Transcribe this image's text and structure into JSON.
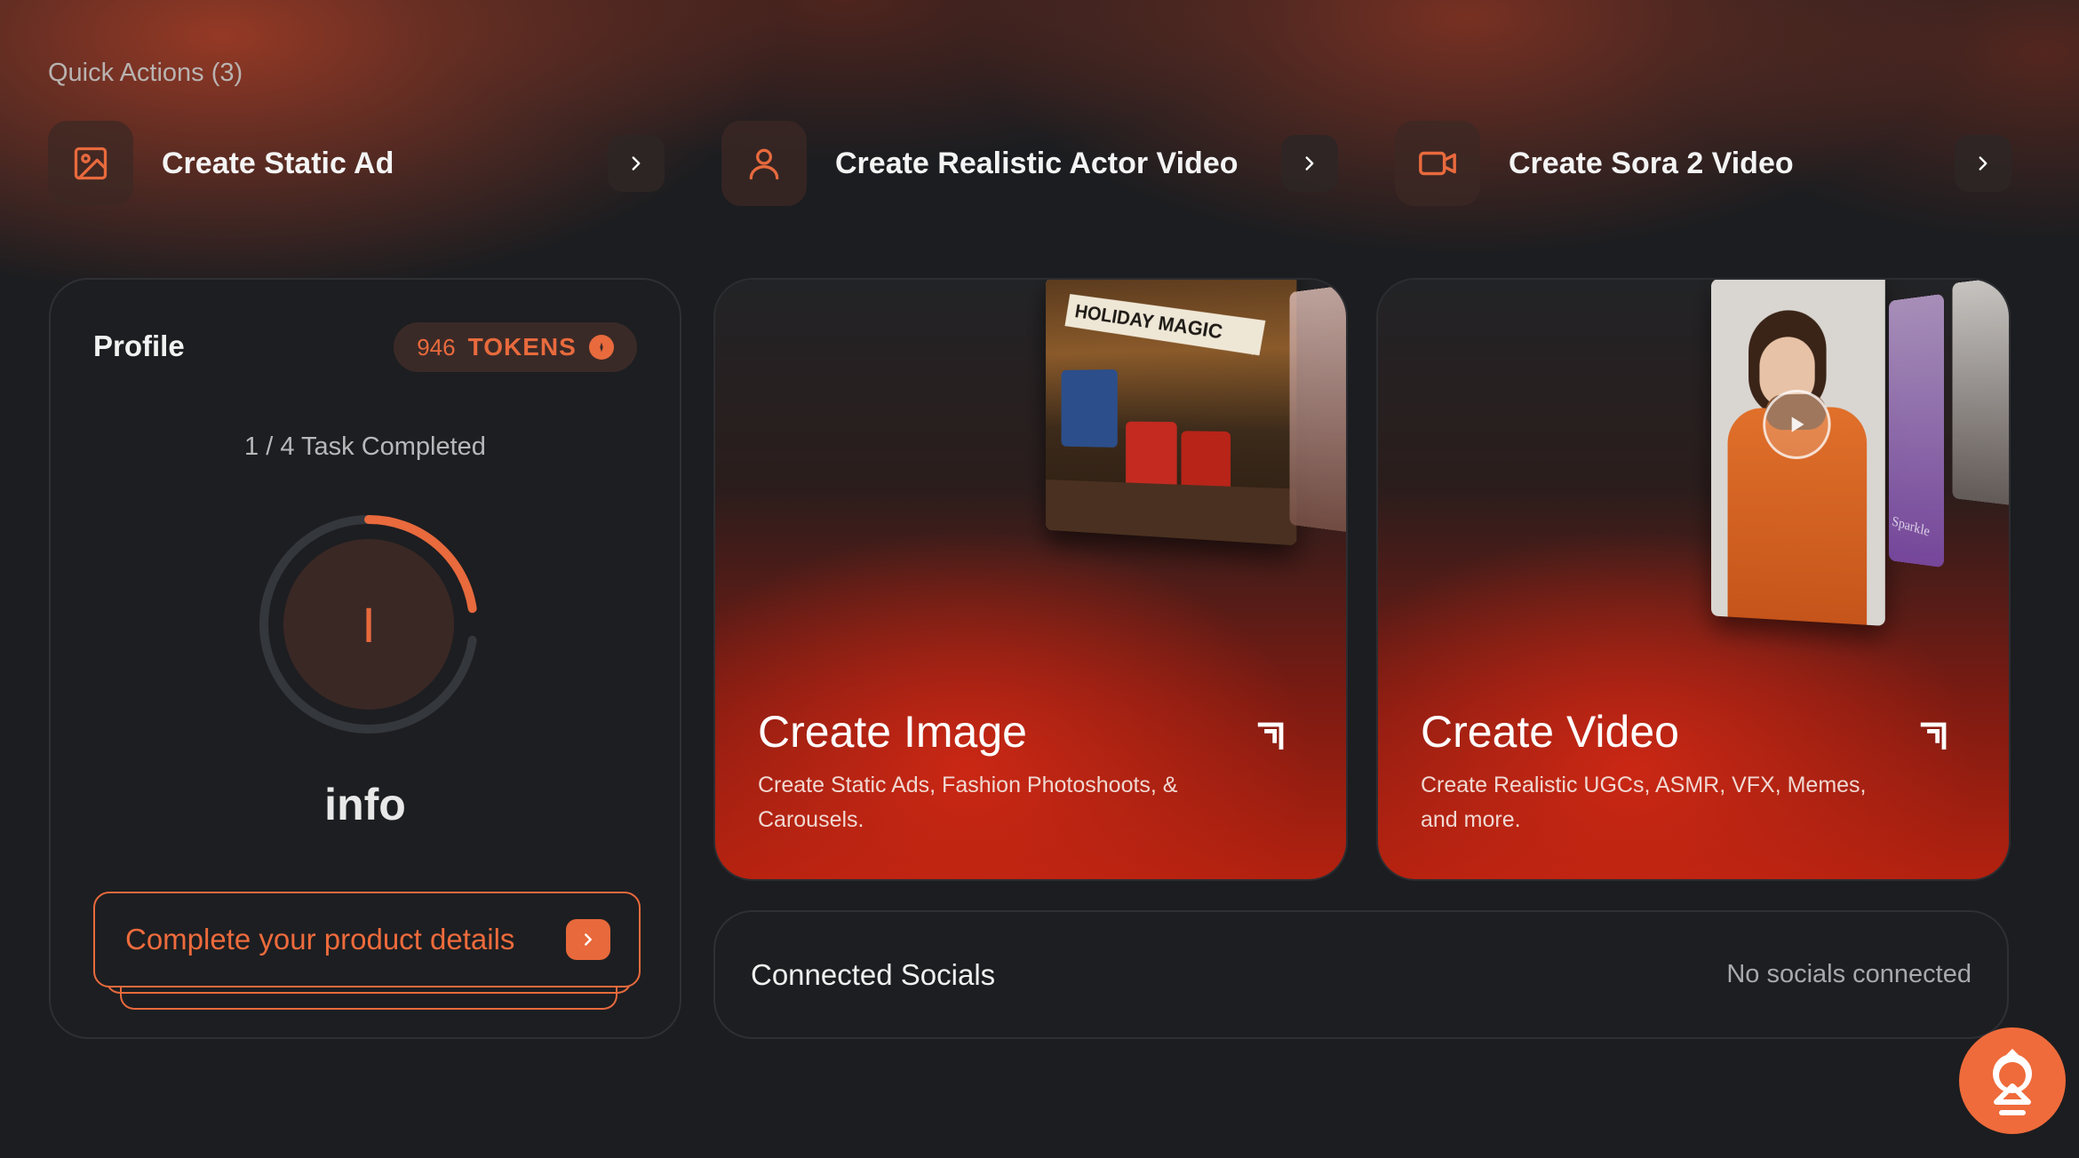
{
  "quick_actions": {
    "title": "Quick Actions (3)",
    "items": [
      {
        "label": "Create Static Ad",
        "icon": "image-icon"
      },
      {
        "label": "Create Realistic Actor Video",
        "icon": "user-icon"
      },
      {
        "label": "Create Sora 2 Video",
        "icon": "video-camera-icon"
      }
    ]
  },
  "profile": {
    "title": "Profile",
    "tokens_count": "946",
    "tokens_label": "TOKENS",
    "task_progress": "1 / 4 Task Completed",
    "progress_fraction": 0.25,
    "avatar_initial": "I",
    "name": "info",
    "cta_label": "Complete your product details"
  },
  "cards": [
    {
      "title": "Create Image",
      "description": "Create Static Ads, Fashion Photoshoots, & Carousels."
    },
    {
      "title": "Create Video",
      "description": "Create Realistic UGCs, ASMR, VFX, Memes, and more."
    }
  ],
  "thumbnail_text": {
    "holiday_poster": "HOLIDAY MAGIC",
    "sparkle_tag": "Sparkle"
  },
  "socials": {
    "title": "Connected Socials",
    "status": "No socials connected"
  },
  "colors": {
    "accent": "#e86a3d",
    "background": "#1c1d20",
    "card_border": "#2e3034"
  }
}
